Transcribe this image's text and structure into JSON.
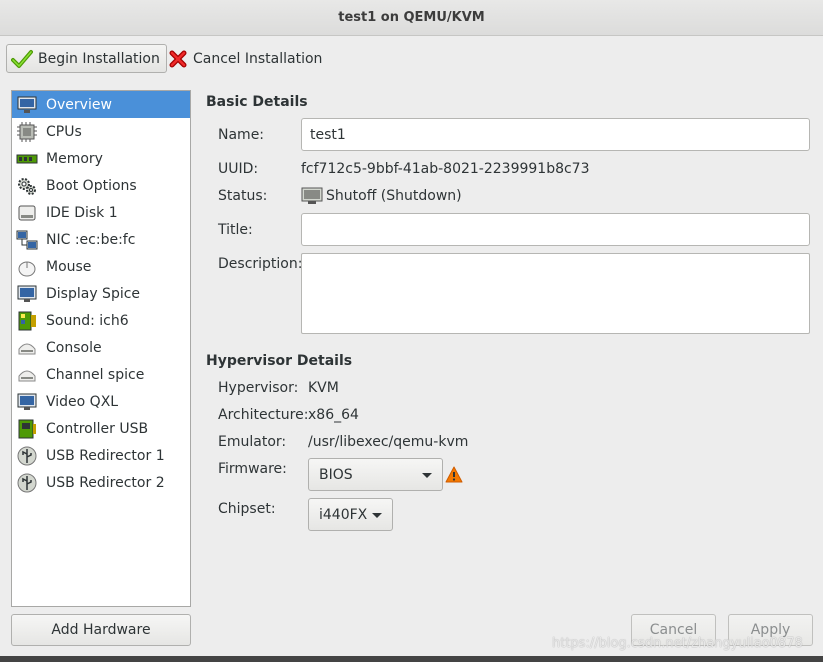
{
  "window": {
    "title": "test1 on QEMU/KVM"
  },
  "toolbar": {
    "begin_label": "Begin Installation",
    "cancel_label": "Cancel Installation"
  },
  "hardware": {
    "items": [
      {
        "label": "Overview",
        "icon": "monitor-icon"
      },
      {
        "label": "CPUs",
        "icon": "cpu-chip-icon"
      },
      {
        "label": "Memory",
        "icon": "memory-stick-icon"
      },
      {
        "label": "Boot Options",
        "icon": "gears-icon"
      },
      {
        "label": "IDE Disk 1",
        "icon": "hard-disk-icon"
      },
      {
        "label": "NIC :ec:be:fc",
        "icon": "network-icon"
      },
      {
        "label": "Mouse",
        "icon": "mouse-icon"
      },
      {
        "label": "Display Spice",
        "icon": "display-icon"
      },
      {
        "label": "Sound: ich6",
        "icon": "sound-card-icon"
      },
      {
        "label": "Console",
        "icon": "serial-console-icon"
      },
      {
        "label": "Channel spice",
        "icon": "channel-icon"
      },
      {
        "label": "Video QXL",
        "icon": "video-icon"
      },
      {
        "label": "Controller USB",
        "icon": "controller-card-icon"
      },
      {
        "label": "USB Redirector 1",
        "icon": "usb-icon"
      },
      {
        "label": "USB Redirector 2",
        "icon": "usb-icon"
      }
    ],
    "add_label": "Add Hardware"
  },
  "basic": {
    "title": "Basic Details",
    "name_label": "Name:",
    "name_value": "test1",
    "uuid_label": "UUID:",
    "uuid_value": "fcf712c5-9bbf-41ab-8021-2239991b8c73",
    "status_label": "Status:",
    "status_value": "Shutoff (Shutdown)",
    "title_label": "Title:",
    "title_value": "",
    "description_label": "Description:"
  },
  "hypervisor": {
    "title": "Hypervisor Details",
    "hypervisor_label": "Hypervisor:",
    "hypervisor_value": "KVM",
    "arch_label": "Architecture:",
    "arch_value": "x86_64",
    "emulator_label": "Emulator:",
    "emulator_value": "/usr/libexec/qemu-kvm",
    "firmware_label": "Firmware:",
    "firmware_value": "BIOS",
    "chipset_label": "Chipset:",
    "chipset_value": "i440FX"
  },
  "buttons": {
    "cancel": "Cancel",
    "apply": "Apply"
  },
  "watermark": "https://blog.csdn.net/zhangyuliao0878",
  "colors": {
    "selection": "#4a90d9",
    "warning": "#f57900"
  }
}
